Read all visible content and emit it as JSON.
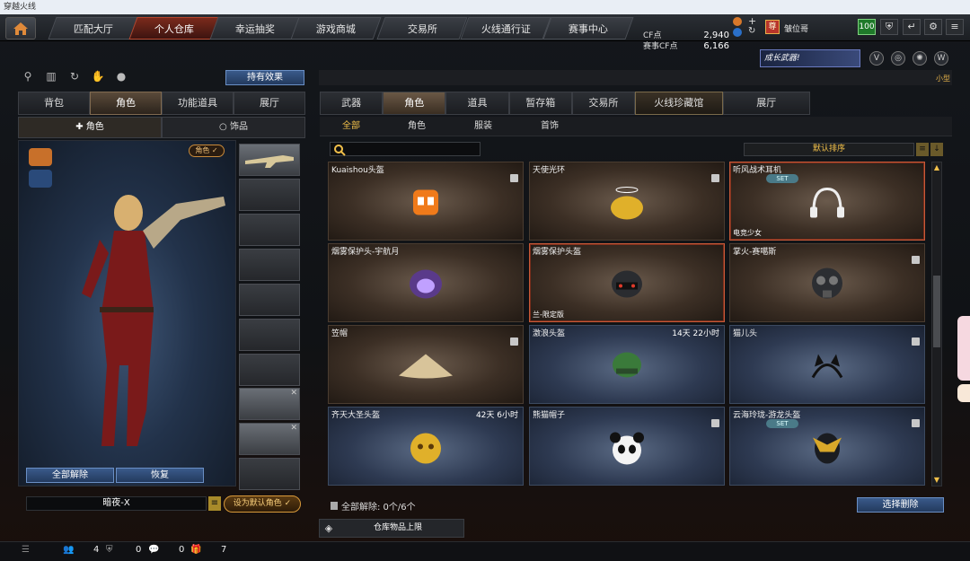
{
  "window": {
    "title": "穿越火线"
  },
  "nav": {
    "tabs": [
      "匹配大厅",
      "个人仓库",
      "幸运抽奖",
      "游戏商城",
      "交易所",
      "火线通行证",
      "赛事中心"
    ],
    "active": 1
  },
  "currency": {
    "cf_label": "CF点",
    "cf_value": "2,940",
    "match_label": "赛事CF点",
    "match_value": "6,166"
  },
  "player": {
    "name": "皱位哥",
    "badge": "尊",
    "level": "100"
  },
  "left_panel": {
    "effect_button": "持有效果",
    "tabs": [
      "背包",
      "角色",
      "功能道具",
      "展厅"
    ],
    "active_tab": 1,
    "subtabs": [
      "角色",
      "饰品"
    ],
    "role_badge": "角色 ✓",
    "unequip_all": "全部解除",
    "restore": "恢复",
    "character_name": "暗夜-X",
    "set_default": "设为默认角色 ✓"
  },
  "promo": {
    "label": "成长武器!",
    "size_label": "小型"
  },
  "right_panel": {
    "tabs": [
      "武器",
      "角色",
      "道具",
      "暂存箱",
      "交易所",
      "火线珍藏馆",
      "展厅"
    ],
    "active_tab": 1,
    "subtabs": [
      "全部",
      "角色",
      "服装",
      "首饰"
    ],
    "active_subtab": 0,
    "sort_label": "默认排序",
    "items": [
      {
        "name": "Kuaishou头盔",
        "time": "",
        "tag": "",
        "set": "",
        "art": "kuaishou-icon"
      },
      {
        "name": "天使光环",
        "time": "",
        "tag": "",
        "set": "",
        "art": "halo-icon"
      },
      {
        "name": "听风战术耳机",
        "time": "",
        "tag": "电竞少女",
        "set": "SET",
        "art": "headphones-icon"
      },
      {
        "name": "烟雾保护头-宇航月",
        "time": "",
        "tag": "",
        "set": "",
        "art": "helmet-icon"
      },
      {
        "name": "烟雾保护头盔",
        "time": "",
        "tag": "兰-限定版",
        "set": "",
        "art": "tactical-helmet-icon"
      },
      {
        "name": "掌火-赛噶斯",
        "time": "",
        "tag": "",
        "set": "",
        "art": "gasmask-icon"
      },
      {
        "name": "笠帽",
        "time": "",
        "tag": "",
        "set": "",
        "art": "straw-hat-icon"
      },
      {
        "name": "激浪头盔",
        "time": "14天 22小时",
        "tag": "",
        "set": "",
        "art": "green-helmet-icon"
      },
      {
        "name": "猫儿头",
        "time": "",
        "tag": "",
        "set": "",
        "art": "cat-ears-icon"
      },
      {
        "name": "齐天大圣头盔",
        "time": "42天 6小时",
        "tag": "",
        "set": "",
        "art": "monkey-helmet-icon"
      },
      {
        "name": "熊猫帽子",
        "time": "",
        "tag": "",
        "set": "",
        "art": "panda-hat-icon"
      },
      {
        "name": "云海玲珑-游龙头盔",
        "time": "",
        "tag": "",
        "set": "SET",
        "art": "dragon-helmet-icon"
      }
    ],
    "bulk_status": "全部解除: 0个/6个",
    "delete_button": "选择删除",
    "limit_label": "仓库物品上限"
  },
  "status_bar": {
    "friends": "4",
    "guild": "0",
    "messages": "0",
    "gifts": "7"
  }
}
